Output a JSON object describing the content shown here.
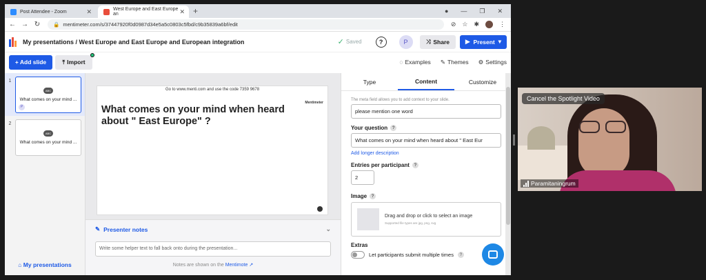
{
  "browser": {
    "tabs": [
      {
        "title": "Post Attendee - Zoom",
        "color": "#2d8cff"
      },
      {
        "title": "West Europe and East Europe an",
        "color": "#e94e3c"
      }
    ],
    "url": "mentimeter.com/s/37447920f0d0987d34e5a5c0803c5fbd/c9b35839a6bf/edit"
  },
  "menti": {
    "breadcrumb": "My presentations / West Europe and  East Europe and European integration",
    "saved": "Saved",
    "avatar": "P",
    "share": "Share",
    "present": "Present",
    "add_slide": "+ Add slide",
    "import": "Import",
    "examples": "Examples",
    "themes": "Themes",
    "settings": "Settings"
  },
  "slides": [
    {
      "num": "1",
      "badge": "ABC",
      "title": "What comes on your mind ...",
      "user": "P"
    },
    {
      "num": "2",
      "badge": "ABC",
      "title": "What comes on your mind ..."
    }
  ],
  "sidebar": {
    "my_presentations": "My presentations"
  },
  "canvas": {
    "code_line": "Go to www.menti.com and use the code 7359 9678",
    "question": "What comes on your mind when heard about \" East Europe\" ?",
    "logo": "Mentimeter"
  },
  "notes": {
    "title": "Presenter notes",
    "placeholder": "Write some helper text to fall back onto during the presentation...",
    "footer_pre": "Notes are shown on the ",
    "footer_link": "Mentimote"
  },
  "panel": {
    "tabs": [
      "Type",
      "Content",
      "Customize"
    ],
    "meta_hint": "The meta field allows you to add context to your slide.",
    "meta_value": "please mention one word",
    "question_label": "Your question",
    "question_value": "What comes on your mind when heard about \" East Eur",
    "add_longer": "Add longer description",
    "entries_label": "Entries per participant",
    "entries_value": "2",
    "image_label": "Image",
    "image_drop": "Drag and drop or click to select an image",
    "image_types": "Supported file types are jpg, png, svg",
    "extras_label": "Extras",
    "extras_option": "Let participants submit multiple times"
  },
  "video": {
    "spotlight": "Cancel the Spotlight Video",
    "name": "Paramitaningrum"
  }
}
